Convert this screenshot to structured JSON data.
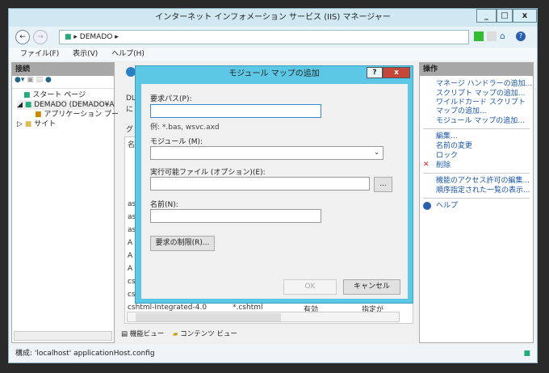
{
  "window": {
    "title": "インターネット インフォメーション サービス (IIS) マネージャー",
    "minimize": "_",
    "maximize": "□",
    "close": "x"
  },
  "nav": {
    "breadcrumb": "DEMADO",
    "sep": "▸"
  },
  "menu": [
    "ファイル(F)",
    "表示(V)",
    "ヘルプ(H)"
  ],
  "connections": {
    "header": "接続",
    "tree": [
      "スタート ページ",
      "DEMADO (DEMADO¥A",
      "アプリケーション プール",
      "サイト"
    ]
  },
  "center": {
    "desc": [
      "DL",
      "に"
    ],
    "group": "グ",
    "col": "名",
    "rows": [
      "as",
      "as",
      "as",
      "A",
      "A",
      "A",
      "cs",
      "cs",
      "cs"
    ],
    "last_row": [
      "cshtml-Integrated-4.0",
      "*.cshtml",
      "有効",
      "指定が"
    ],
    "view_features": "機能ビュー",
    "view_content": "コンテンツ ビュー"
  },
  "actions": {
    "header": "操作",
    "group1": [
      "マネージ ハンドラーの追加...",
      "スクリプト マップの追加...",
      "ワイルドカード スクリプト マップの追加...",
      "モジュール マップの追加..."
    ],
    "group2": [
      "編集...",
      "名前の変更",
      "ロック",
      "削除"
    ],
    "group3": [
      "機能のアクセス許可の編集...",
      "順序指定された一覧の表示..."
    ],
    "help": "ヘルプ"
  },
  "dialog": {
    "title": "モジュール マップの追加",
    "help": "?",
    "close": "x",
    "request_path_label": "要求パス(P):",
    "request_path_value": "",
    "example": "例: *.bas, wsvc.axd",
    "module_label": "モジュール (M):",
    "module_value": "",
    "exe_label": "実行可能ファイル (オプション)(E):",
    "exe_value": "",
    "browse": "...",
    "name_label": "名前(N):",
    "name_value": "",
    "restrictions": "要求の制限(R)...",
    "ok": "OK",
    "cancel": "キャンセル"
  },
  "status": {
    "text": "構成: 'localhost' applicationHost.config"
  }
}
